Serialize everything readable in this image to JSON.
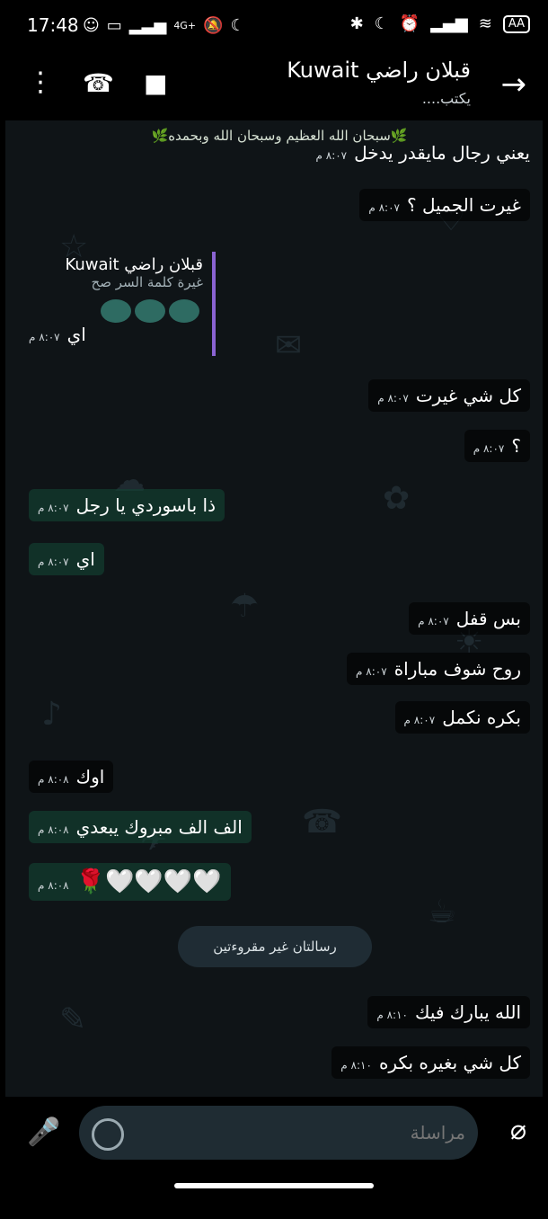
{
  "statusbar": {
    "time": "17:48",
    "network": "4G+",
    "battery": "AA"
  },
  "header": {
    "contact_name": "قبلان راضي Kuwait",
    "contact_status": "يكتب...."
  },
  "chat": {
    "banner": "🌿سبحان الله العظيم وسبحان الله وبحمده🌿",
    "quote": {
      "name": "قبلان راضي Kuwait",
      "text": "غيرة كلمة السر صح"
    },
    "messages": [
      {
        "text": "يعني رجال مايقدر يدخل",
        "time": "٨:٠٧ م"
      },
      {
        "text": "غيرت الجميل ؟",
        "time": "٨:٠٧ م"
      },
      {
        "text": "اي",
        "time": "٨:٠٧ م"
      },
      {
        "text": "كل شي غيرت",
        "time": "٨:٠٧ م"
      },
      {
        "text": "؟",
        "time": "٨:٠٧ م"
      },
      {
        "text": "ذا باسوردي يا رجل",
        "time": "٨:٠٧ م"
      },
      {
        "text": "اي",
        "time": "٨:٠٧ م"
      },
      {
        "text": "بس قفل",
        "time": "٨:٠٧ م"
      },
      {
        "text": "روح شوف مباراة",
        "time": "٨:٠٧ م"
      },
      {
        "text": "بكره نكمل",
        "time": "٨:٠٧ م"
      },
      {
        "text": "اوك",
        "time": "٨:٠٨ م"
      },
      {
        "text": "الف الف مبروك يبعدي",
        "time": "٨:٠٨ م"
      },
      {
        "text": "🤍🤍🤍🤍🌹",
        "time": "٨:٠٨ م"
      },
      {
        "text": "الله يبارك فيك",
        "time": "٨:١٠ م"
      },
      {
        "text": "كل شي بغيره بكره",
        "time": "٨:١٠ م"
      }
    ],
    "unread_label": "رسالتان غير مقروءتين"
  },
  "input": {
    "placeholder": "مراسلة"
  },
  "colors": {
    "background": "#0f1417",
    "incoming_tint": "#124434",
    "accent": "#8a63d2"
  }
}
